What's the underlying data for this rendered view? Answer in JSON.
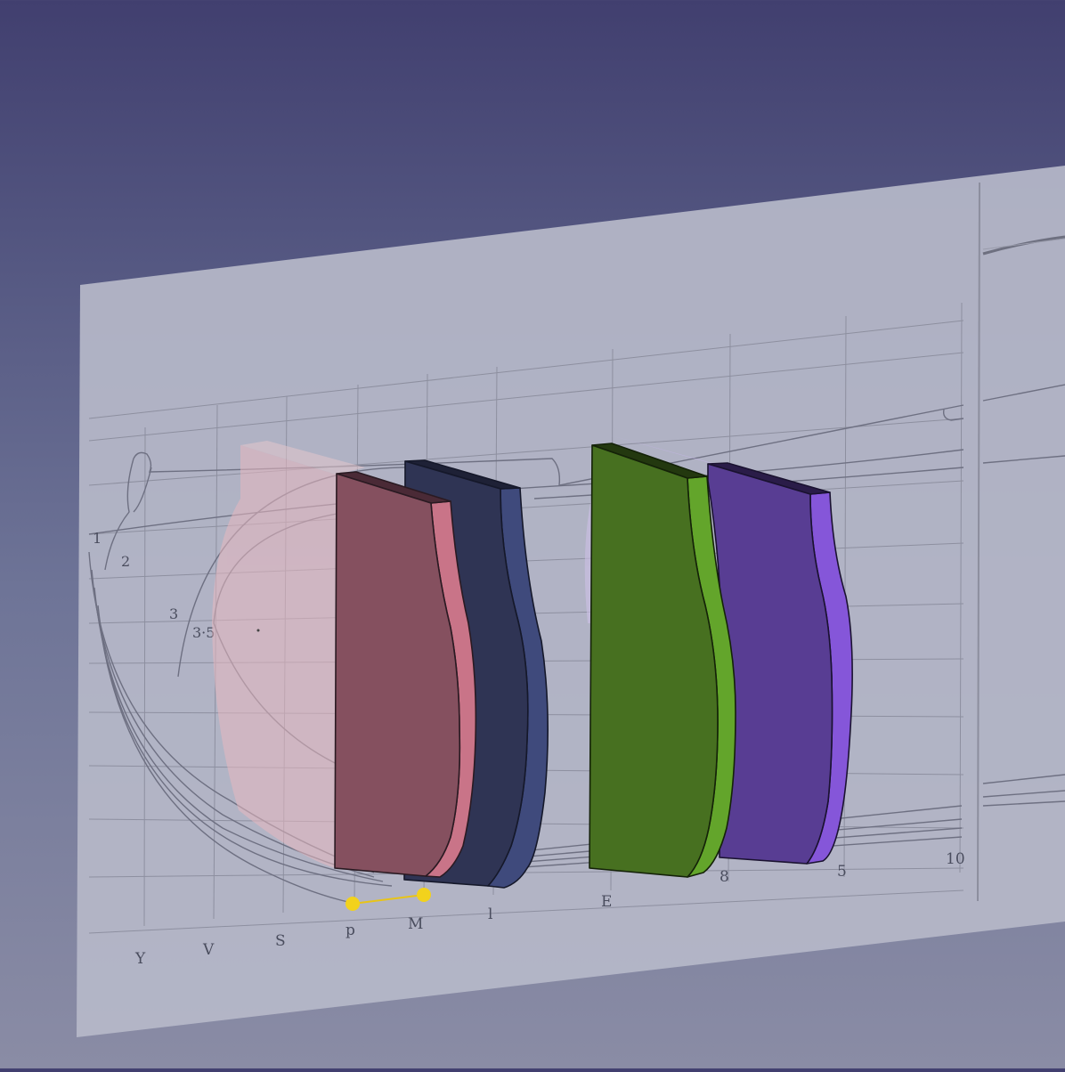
{
  "viewport": {
    "background_top": "#413f6f",
    "background_bottom": "#8a8ca5"
  },
  "blueprint": {
    "plane_color": "#b6b8c8",
    "station_labels_bottom": [
      "Y",
      "V",
      "S",
      "p",
      "M",
      "l",
      "E",
      "8",
      "5",
      "10"
    ],
    "waterline_labels": [
      "1",
      "2",
      "3",
      "3·5"
    ]
  },
  "frames": [
    {
      "name": "frame-pink-ghost",
      "face": "#e2b8c0",
      "edge": "#e2b8c0"
    },
    {
      "name": "frame-pink",
      "face": "#85505f",
      "edge": "#c97488"
    },
    {
      "name": "frame-navy",
      "face": "#2f3454",
      "edge": "#3f4a7c"
    },
    {
      "name": "frame-green",
      "face": "#477020",
      "edge": "#63a52b"
    },
    {
      "name": "frame-purple",
      "face": "#583d93",
      "edge": "#8556d9"
    }
  ],
  "selection": {
    "color": "#f2d21c"
  }
}
